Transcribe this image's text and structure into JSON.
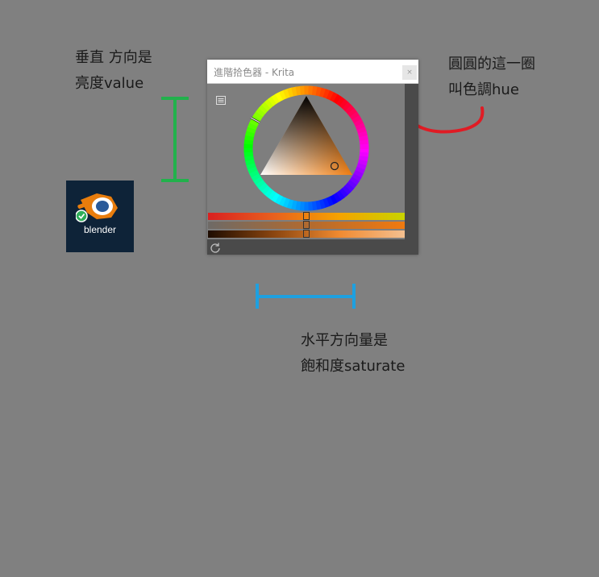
{
  "annotations": {
    "value_note": [
      "垂直 方向是",
      "亮度value"
    ],
    "hue_note": [
      "圓圓的這一圈",
      "叫色調hue"
    ],
    "saturation_note": [
      "水平方向量是",
      "飽和度saturate"
    ],
    "colors": {
      "value_marker": "#22b14c",
      "hue_marker": "#e01b24",
      "saturation_marker": "#1ea0e0"
    }
  },
  "desktop_icon": {
    "label": "blender"
  },
  "window": {
    "title": "進階拾色器 - Krita",
    "close_label": "×"
  },
  "color_selector": {
    "hue_color": "#f07d10",
    "slider_positions": {
      "hue": 0.5,
      "saturation": 0.5,
      "value": 0.5
    }
  }
}
